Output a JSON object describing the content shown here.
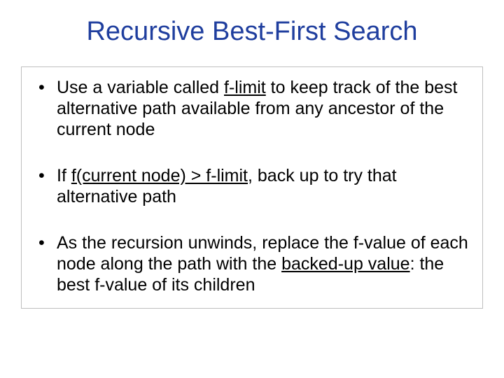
{
  "title": "Recursive Best-First Search",
  "bullets": [
    {
      "p1": "Use a variable called ",
      "u1": "f-limit",
      "p2": " to keep track of the best alternative path available from any ancestor of the current node"
    },
    {
      "p1": "If ",
      "u1": "f(current node) > f-limit",
      "p2": ", back up to try that alternative path"
    },
    {
      "p1": "As the recursion unwinds, replace the f-value of each node along the path with the ",
      "u1": "backed-up value",
      "p2": ": the best f-value of its children"
    }
  ]
}
